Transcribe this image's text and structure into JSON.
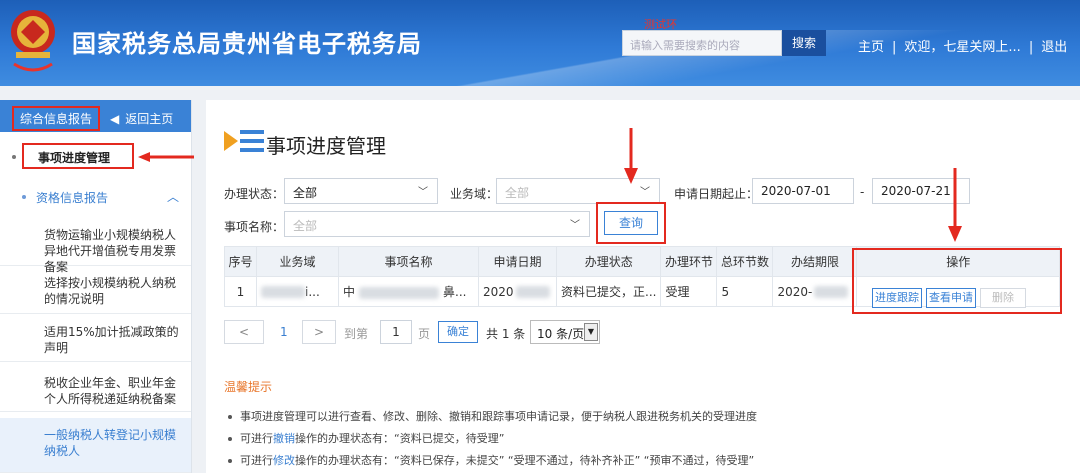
{
  "header": {
    "site_title": "国家税务总局贵州省电子税务局",
    "test_env": "测试环",
    "search_placeholder": "请输入需要搜索的内容",
    "search_button": "搜索",
    "nav_home": "主页",
    "nav_welcome": "欢迎，七星关网上...",
    "nav_logout": "退出",
    "brand_color": "#2f7ad6"
  },
  "sidebar": {
    "tab_active": "综合信息报告",
    "tab_home": "返回主页",
    "current_item": "事项进度管理",
    "group_title": "资格信息报告",
    "items": [
      {
        "label": "货物运输业小规模纳税人异地代开增值税专用发票备案"
      },
      {
        "label": "选择按小规模纳税人纳税的情况说明"
      },
      {
        "label": "适用15%加计抵减政策的声明"
      },
      {
        "label": "税收企业年金、职业年金个人所得税递延纳税备案"
      },
      {
        "label": "一般纳税人转登记小规模纳税人"
      }
    ]
  },
  "main": {
    "title": "事项进度管理",
    "filters": {
      "status_label": "办理状态：",
      "status_value": "全部",
      "domain_label": "业务域：",
      "domain_value": "全部",
      "date_label": "申请日期起止：",
      "date_from": "2020-07-01",
      "date_sep": "-",
      "date_to": "2020-07-21",
      "name_label": "事项名称：",
      "name_value": "全部",
      "query_button": "查询"
    },
    "table": {
      "headers": [
        "序号",
        "业务域",
        "事项名称",
        "申请日期",
        "办理状态",
        "办理环节",
        "总环节数",
        "办结期限",
        "操作"
      ],
      "row": {
        "index": "1",
        "domain_tail": "i...",
        "name_head": "中",
        "name_tail": "鼻...",
        "date_head": "2020",
        "status": "资料已提交，正...",
        "step": "受理",
        "total_steps": "5",
        "deadline_head": "2020-"
      },
      "actions": {
        "track": "进度跟踪",
        "view": "查看申请",
        "delete": "删除"
      }
    },
    "pagination": {
      "prev": "<",
      "current_page": "1",
      "next": ">",
      "goto_label": "到第",
      "page_input": "1",
      "page_unit": "页",
      "confirm": "确定",
      "total": "共 1 条",
      "page_size": "10 条/页"
    },
    "tips": {
      "title": "温馨提示",
      "line1": "事项进度管理可以进行查看、修改、删除、撤销和跟踪事项申请记录，便于纳税人跟进税务机关的受理进度",
      "line2_prefix": "可进行",
      "line2_action": "撤销",
      "line2_suffix": "操作的办理状态有：“资料已提交，待受理”",
      "line3_prefix": "可进行",
      "line3_action": "修改",
      "line3_suffix": "操作的办理状态有：“资料已保存，未提交”  “受理不通过，待补齐补正”  “预审不通过，待受理”"
    }
  }
}
